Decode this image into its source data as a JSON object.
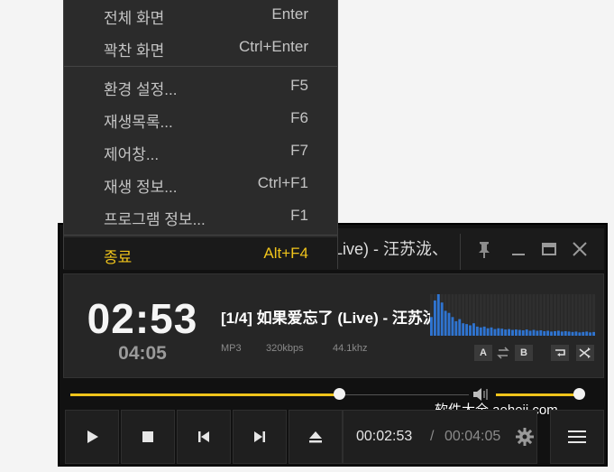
{
  "player": {
    "title": "Live) - 汪苏泷、",
    "current_time": "02:53",
    "total_time": "04:05",
    "track_title": "[1/4] 如果爱忘了 (Live) - 汪苏泷、",
    "format": "MP3",
    "bitrate": "320kbps",
    "frequency": "44.1khz",
    "ab_a": "A",
    "ab_b": "B",
    "seek_progress": 0.7,
    "volume": 0.94,
    "time_current": "00:02:53",
    "time_separator": "/",
    "time_total": "00:04:05",
    "accent_color": "#f0c41b"
  },
  "spectrum_levels": [
    0.45,
    0.85,
    1.0,
    0.8,
    0.6,
    0.55,
    0.45,
    0.35,
    0.4,
    0.3,
    0.28,
    0.25,
    0.3,
    0.22,
    0.2,
    0.22,
    0.18,
    0.2,
    0.16,
    0.18,
    0.17,
    0.15,
    0.16,
    0.14,
    0.15,
    0.14,
    0.13,
    0.15,
    0.12,
    0.14,
    0.12,
    0.13,
    0.11,
    0.12,
    0.1,
    0.11,
    0.12,
    0.1,
    0.11,
    0.1,
    0.09,
    0.1,
    0.08,
    0.09,
    0.1,
    0.08,
    0.09
  ],
  "watermark": "软件大全 aeheji.com",
  "menu": {
    "items": [
      {
        "label": "전체 화면",
        "key": "Enter"
      },
      {
        "label": "꽉찬 화면",
        "key": "Ctrl+Enter"
      },
      {
        "label": "환경 설정...",
        "key": "F5"
      },
      {
        "label": "재생목록...",
        "key": "F6"
      },
      {
        "label": "제어창...",
        "key": "F7"
      },
      {
        "label": "재생 정보...",
        "key": "Ctrl+F1"
      },
      {
        "label": "프로그램 정보...",
        "key": "F1"
      },
      {
        "label": "종료",
        "key": "Alt+F4"
      }
    ]
  }
}
